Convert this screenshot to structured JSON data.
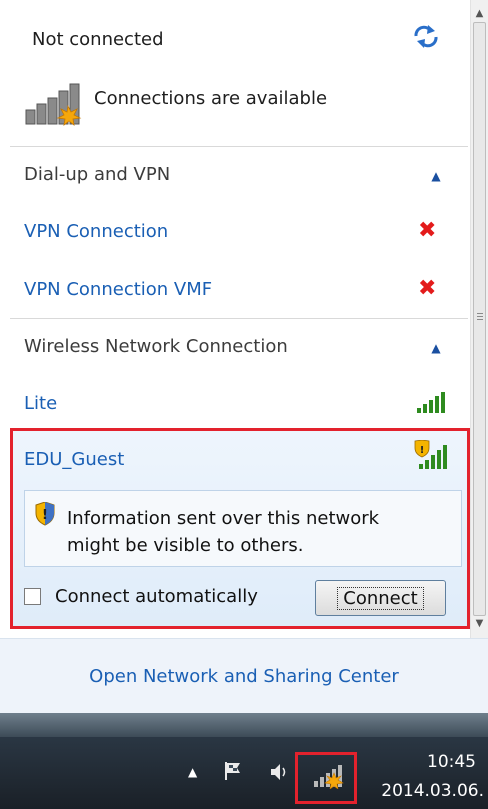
{
  "status": {
    "title": "Not connected",
    "subtitle": "Connections are available"
  },
  "dialup": {
    "heading": "Dial-up and VPN",
    "items": [
      {
        "name": "VPN Connection"
      },
      {
        "name": "VPN Connection VMF"
      }
    ]
  },
  "wireless": {
    "heading": "Wireless Network Connection",
    "networks": [
      {
        "name": "Lite",
        "secured": true
      },
      {
        "name": "EDU_Guest",
        "secured": false
      }
    ],
    "selected": {
      "warning": "Information sent over this network might be visible to others.",
      "warning_line1": "Information sent over this network",
      "warning_line2": "might be visible to others.",
      "auto_connect_label": "Connect automatically",
      "auto_connect_checked": false,
      "connect_button_label": "Connect"
    }
  },
  "footer": {
    "link": "Open Network and Sharing Center"
  },
  "taskbar": {
    "time": "10:45",
    "date": "2014.03.06."
  },
  "colors": {
    "link": "#1a5fb4",
    "highlight_border": "#e3222d",
    "remove_x": "#e31b1b",
    "signal_green": "#2e8b1f"
  },
  "icons": [
    "refresh-icon",
    "network-warning-icon",
    "chevron-up-icon",
    "remove-icon",
    "signal-strength-icon",
    "shield-warning-icon",
    "flag-icon",
    "volume-icon",
    "network-tray-icon"
  ]
}
